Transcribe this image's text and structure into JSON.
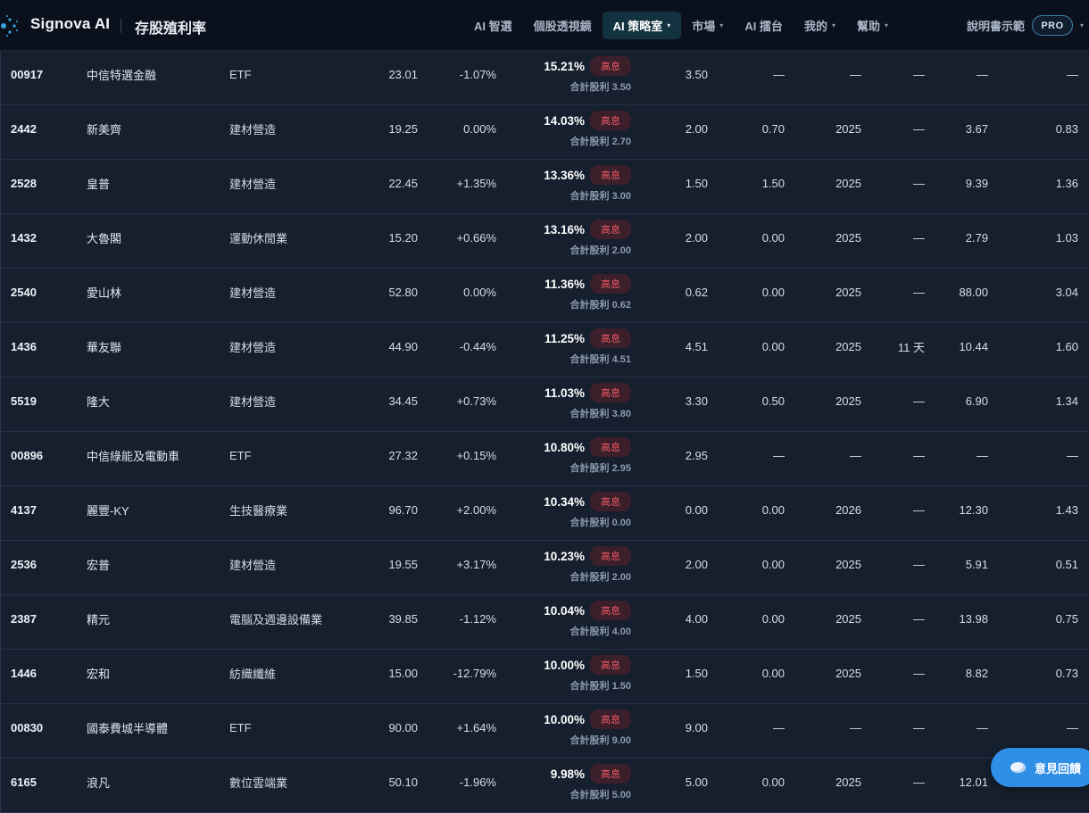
{
  "header": {
    "brand": "Signova AI",
    "page_title": "存股殖利率",
    "nav": [
      {
        "label": "AI 智選",
        "caret": false,
        "active": false
      },
      {
        "label": "個股透視鏡",
        "caret": false,
        "active": false
      },
      {
        "label": "AI 策略室",
        "caret": true,
        "active": true
      },
      {
        "label": "市場",
        "caret": true,
        "active": false
      },
      {
        "label": "AI 擂台",
        "caret": false,
        "active": false
      },
      {
        "label": "我的",
        "caret": true,
        "active": false
      },
      {
        "label": "幫助",
        "caret": true,
        "active": false
      }
    ],
    "manual_label": "說明書示範",
    "pro_badge": "PRO",
    "caret_glyph": "▾"
  },
  "table": {
    "yield_badge_label": "高息",
    "sum_prefix": "合計股利",
    "rows": [
      {
        "code": "00917",
        "name": "中信特選金融",
        "industry": "ETF",
        "price": "23.01",
        "change": "-1.07%",
        "yield": "15.21%",
        "sum": "3.50",
        "cash": "3.50",
        "stock": "—",
        "year": "—",
        "days": "—",
        "pe": "—",
        "pb": "—"
      },
      {
        "code": "2442",
        "name": "新美齊",
        "industry": "建材營造",
        "price": "19.25",
        "change": "0.00%",
        "yield": "14.03%",
        "sum": "2.70",
        "cash": "2.00",
        "stock": "0.70",
        "year": "2025",
        "days": "—",
        "pe": "3.67",
        "pb": "0.83"
      },
      {
        "code": "2528",
        "name": "皇普",
        "industry": "建材營造",
        "price": "22.45",
        "change": "+1.35%",
        "yield": "13.36%",
        "sum": "3.00",
        "cash": "1.50",
        "stock": "1.50",
        "year": "2025",
        "days": "—",
        "pe": "9.39",
        "pb": "1.36"
      },
      {
        "code": "1432",
        "name": "大魯閣",
        "industry": "運動休閒業",
        "price": "15.20",
        "change": "+0.66%",
        "yield": "13.16%",
        "sum": "2.00",
        "cash": "2.00",
        "stock": "0.00",
        "year": "2025",
        "days": "—",
        "pe": "2.79",
        "pb": "1.03"
      },
      {
        "code": "2540",
        "name": "愛山林",
        "industry": "建材營造",
        "price": "52.80",
        "change": "0.00%",
        "yield": "11.36%",
        "sum": "0.62",
        "cash": "0.62",
        "stock": "0.00",
        "year": "2025",
        "days": "—",
        "pe": "88.00",
        "pb": "3.04"
      },
      {
        "code": "1436",
        "name": "華友聯",
        "industry": "建材營造",
        "price": "44.90",
        "change": "-0.44%",
        "yield": "11.25%",
        "sum": "4.51",
        "cash": "4.51",
        "stock": "0.00",
        "year": "2025",
        "days": "11 天",
        "pe": "10.44",
        "pb": "1.60"
      },
      {
        "code": "5519",
        "name": "隆大",
        "industry": "建材營造",
        "price": "34.45",
        "change": "+0.73%",
        "yield": "11.03%",
        "sum": "3.80",
        "cash": "3.30",
        "stock": "0.50",
        "year": "2025",
        "days": "—",
        "pe": "6.90",
        "pb": "1.34"
      },
      {
        "code": "00896",
        "name": "中信綠能及電動車",
        "industry": "ETF",
        "price": "27.32",
        "change": "+0.15%",
        "yield": "10.80%",
        "sum": "2.95",
        "cash": "2.95",
        "stock": "—",
        "year": "—",
        "days": "—",
        "pe": "—",
        "pb": "—"
      },
      {
        "code": "4137",
        "name": "麗豐-KY",
        "industry": "生技醫療業",
        "price": "96.70",
        "change": "+2.00%",
        "yield": "10.34%",
        "sum": "0.00",
        "cash": "0.00",
        "stock": "0.00",
        "year": "2026",
        "days": "—",
        "pe": "12.30",
        "pb": "1.43"
      },
      {
        "code": "2536",
        "name": "宏普",
        "industry": "建材營造",
        "price": "19.55",
        "change": "+3.17%",
        "yield": "10.23%",
        "sum": "2.00",
        "cash": "2.00",
        "stock": "0.00",
        "year": "2025",
        "days": "—",
        "pe": "5.91",
        "pb": "0.51"
      },
      {
        "code": "2387",
        "name": "精元",
        "industry": "電腦及週邊設備業",
        "price": "39.85",
        "change": "-1.12%",
        "yield": "10.04%",
        "sum": "4.00",
        "cash": "4.00",
        "stock": "0.00",
        "year": "2025",
        "days": "—",
        "pe": "13.98",
        "pb": "0.75"
      },
      {
        "code": "1446",
        "name": "宏和",
        "industry": "紡織纖維",
        "price": "15.00",
        "change": "-12.79%",
        "yield": "10.00%",
        "sum": "1.50",
        "cash": "1.50",
        "stock": "0.00",
        "year": "2025",
        "days": "—",
        "pe": "8.82",
        "pb": "0.73"
      },
      {
        "code": "00830",
        "name": "國泰費城半導體",
        "industry": "ETF",
        "price": "90.00",
        "change": "+1.64%",
        "yield": "10.00%",
        "sum": "9.00",
        "cash": "9.00",
        "stock": "—",
        "year": "—",
        "days": "—",
        "pe": "—",
        "pb": "—"
      },
      {
        "code": "6165",
        "name": "浪凡",
        "industry": "數位雲端業",
        "price": "50.10",
        "change": "-1.96%",
        "yield": "9.98%",
        "sum": "5.00",
        "cash": "5.00",
        "stock": "0.00",
        "year": "2025",
        "days": "—",
        "pe": "12.01",
        "pb": ""
      }
    ]
  },
  "feedback": {
    "label": "意見回饋",
    "icon": "chat-bubble-icon"
  },
  "colors": {
    "accent": "#2f8fe6",
    "badge_text": "#f05a66",
    "badge_bg": "#3b1f2a",
    "active_nav": "#13323f"
  }
}
